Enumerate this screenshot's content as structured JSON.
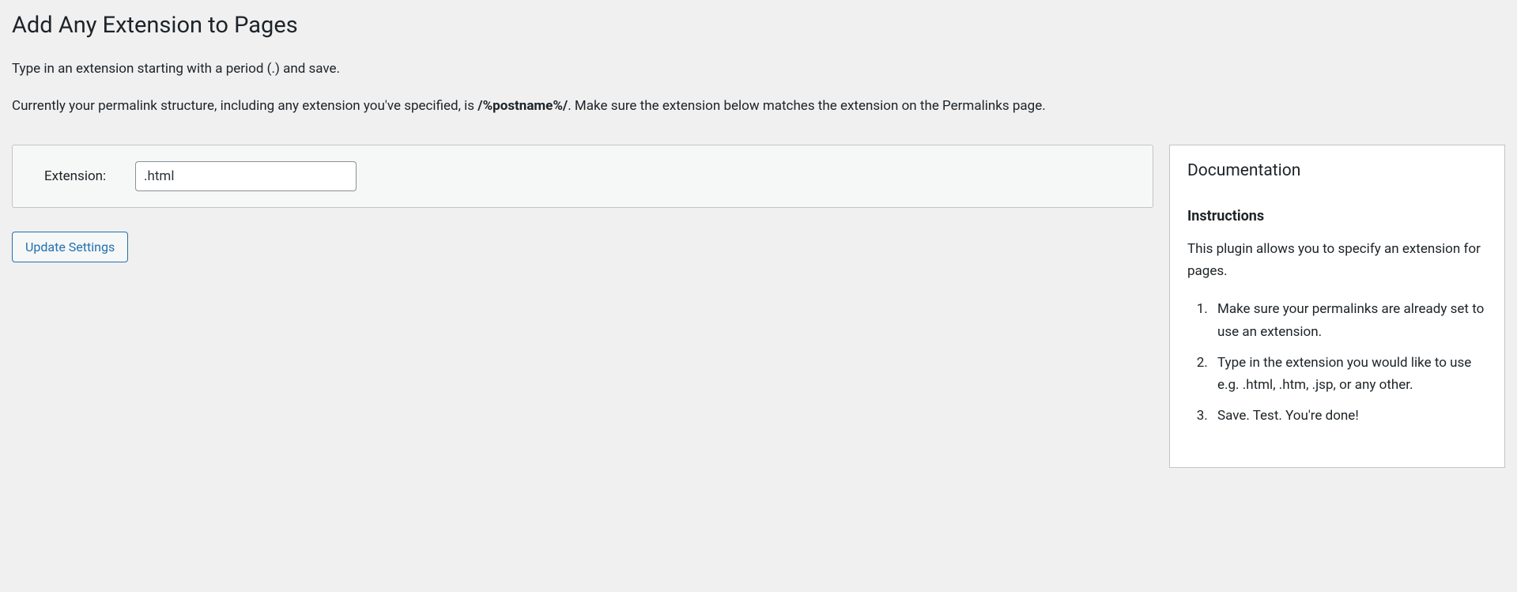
{
  "header": {
    "title": "Add Any Extension to Pages",
    "intro_line1": "Type in an extension starting with a period (.) and save.",
    "intro_line2_prefix": "Currently your permalink structure, including any extension you've specified, is ",
    "intro_line2_bold": "/%postname%/",
    "intro_line2_suffix": ". Make sure the extension below matches the extension on the Permalinks page."
  },
  "form": {
    "label": "Extension:",
    "value": ".html",
    "submit_label": "Update Settings"
  },
  "doc": {
    "heading": "Documentation",
    "subheading": "Instructions",
    "description": "This plugin allows you to specify an extension for pages.",
    "steps": [
      "Make sure your permalinks are already set to use an extension.",
      "Type in the extension you would like to use e.g. .html, .htm, .jsp, or any other.",
      "Save. Test. You're done!"
    ]
  }
}
